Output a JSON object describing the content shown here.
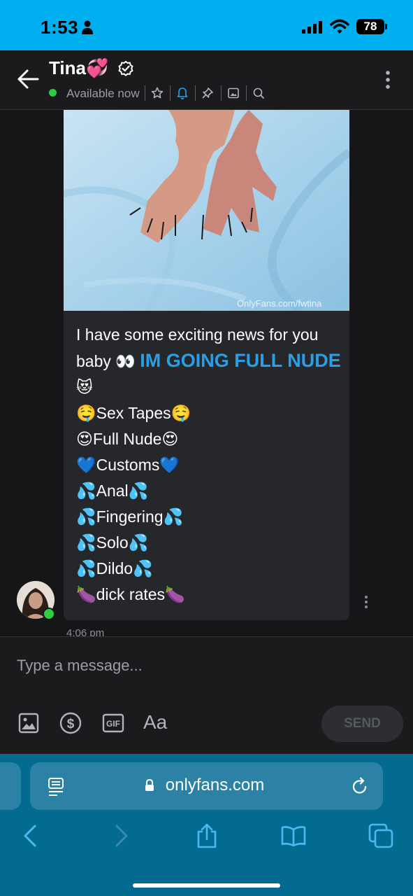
{
  "status": {
    "time": "1:53",
    "battery": "78"
  },
  "header": {
    "name": "Tina",
    "name_emoji": "💞",
    "availability": "Available now"
  },
  "photo": {
    "watermark": "OnlyFans.com/fwtina"
  },
  "message": {
    "intro": "I have some exciting news for you baby 👀 ",
    "highlight": "IM GOING FULL NUDE",
    "highlight_emoji": "😻",
    "lines": [
      "🤤Sex Tapes🤤",
      "😍Full Nude😍",
      "💙Customs💙",
      "💦Anal💦",
      "💦Fingering💦",
      "💦Solo💦",
      "💦Dildo💦",
      "🍆dick rates🍆"
    ],
    "time": "4:06 pm"
  },
  "composer": {
    "placeholder": "Type a message...",
    "send_label": "SEND",
    "text_format_label": "Aa"
  },
  "browser": {
    "url": "onlyfans.com"
  },
  "icons": [
    "person-icon",
    "signal-icon",
    "wifi-icon",
    "back-arrow-icon",
    "verified-icon",
    "star-icon",
    "bell-icon",
    "pin-icon",
    "gallery-icon",
    "search-icon",
    "more-vert-icon",
    "image-icon",
    "dollar-icon",
    "gif-icon",
    "reader-icon",
    "lock-icon",
    "reload-icon",
    "back-icon",
    "forward-icon",
    "share-icon",
    "bookmarks-icon",
    "tabs-icon"
  ],
  "colors": {
    "accent": "#00aff0",
    "highlight": "#2a9fe6",
    "online": "#2ecc40",
    "safari": "#046b90"
  }
}
